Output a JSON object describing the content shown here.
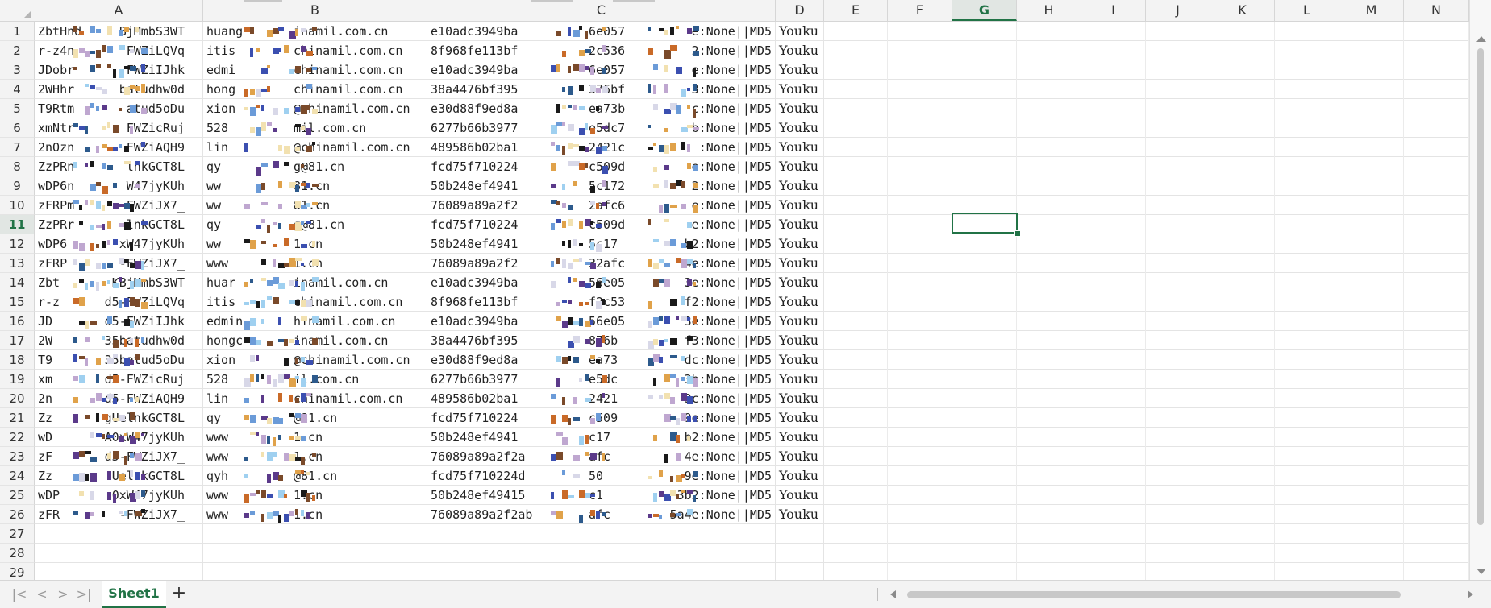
{
  "columns": [
    "A",
    "B",
    "C",
    "D",
    "E",
    "F",
    "G",
    "H",
    "I",
    "J",
    "K",
    "L",
    "M",
    "N"
  ],
  "selected_column": "G",
  "selected_row": "11",
  "row_numbers": [
    "1",
    "2",
    "3",
    "4",
    "5",
    "6",
    "7",
    "8",
    "9",
    "10",
    "11",
    "12",
    "13",
    "14",
    "15",
    "16",
    "17",
    "18",
    "19",
    "20",
    "21",
    "22",
    "23",
    "24",
    "25",
    "26",
    "27",
    "28",
    "29"
  ],
  "rows": [
    {
      "a": "ZbtHnd",
      "a2": "BjMmbS3WT",
      "b": "huang",
      "b2": "inamil.com.cn",
      "c": "e10adc3949ba",
      "c2": "6e057",
      "c3": "e:None||MD5",
      "d": "Youku"
    },
    {
      "a": "r-z4n",
      "a2": "FWZiLQVq",
      "b": "itis",
      "b2": "chinamil.com.cn",
      "c": "8f968fe113bf",
      "c2": "2c536",
      "c3": "2:None||MD5",
      "d": "Youku"
    },
    {
      "a": "JDobr",
      "a2": "FWZiIJhk",
      "b": "edmi",
      "b2": "chinamil.com.cn",
      "c": "e10adc3949ba",
      "c2": "6e057",
      "c3": "e:None||MD5",
      "d": "Youku"
    },
    {
      "a": "2WHhr",
      "a2": "batudhw0d",
      "b": "hong",
      "b2": "chinamil.com.cn",
      "c": "38a4476bf395",
      "c2": "376bf",
      "c3": "3:None||MD5",
      "d": "Youku"
    },
    {
      "a": "T9Rtm",
      "a2": "atud5oDu",
      "b": "xion",
      "b2": "@chinamil.com.cn",
      "c": "e30d88f9ed8a",
      "c2": "ea73b",
      "c3": "c:None||MD5",
      "d": "Youku"
    },
    {
      "a": "xmNtr",
      "a2": "FWZicRuj",
      "b": "528",
      "b2": "mil.com.cn",
      "c": "6277b66b3977",
      "c2": "e5dc7",
      "c3": "b:None||MD5",
      "d": "Youku"
    },
    {
      "a": "2nOzn",
      "a2": "FWZiAQH9",
      "b": "lin",
      "b2": "@chinamil.com.cn",
      "c": "489586b02ba1",
      "c2": "2421c",
      "c3": ":None||MD5",
      "d": "Youku"
    },
    {
      "a": "ZzPRn",
      "a2": "lnkGCT8L",
      "b": "qy",
      "b2": "g@81.cn",
      "c": "fcd75f710224",
      "c2": "c509d",
      "c3": "e:None||MD5",
      "d": "Youku"
    },
    {
      "a": "wDP6n",
      "a2": "W47jyKUh",
      "b": "ww",
      "b2": "81.cn",
      "c": "50b248ef4941",
      "c2": "5c172",
      "c3": "2:None||MD5",
      "d": "Youku"
    },
    {
      "a": "zFRPm",
      "a2": "FWZiJX7_",
      "b": "ww",
      "b2": "81.cn",
      "c": "76089a89a2f2",
      "c2": "2afc6",
      "c3": "e:None||MD5",
      "d": "Youku"
    },
    {
      "a": "ZzPRr",
      "a2": "lnkGCT8L",
      "b": "qy",
      "b2": "g@81.cn",
      "c": "fcd75f710224",
      "c2": "c509d",
      "c3": "e:None||MD5",
      "d": "Youku"
    },
    {
      "a": "wDP6",
      "a2": "xW47jyKUh",
      "b": "ww",
      "b2": "1.cn",
      "c": "50b248ef4941",
      "c2": "5c17",
      "c3": "b2:None||MD5",
      "d": "Youku"
    },
    {
      "a": "zFRP",
      "a2": "-FWZiJX7_",
      "b": "www",
      "b2": "1.cn",
      "c": "76089a89a2f2",
      "c2": "32afc",
      "c3": "4e:None||MD5",
      "d": "Youku"
    },
    {
      "a": "Zbt",
      "a2": "KBjMmbS3WT",
      "b": "huar",
      "b2": "inamil.com.cn",
      "c": "e10adc3949ba",
      "c2": "56e05",
      "c3": "3e:None||MD5",
      "d": "Youku"
    },
    {
      "a": "r-z",
      "a2": "d5-FWZiLQVq",
      "b": "itis",
      "b2": "chinamil.com.cn",
      "c": "8f968fe113bf",
      "c2": "f2c53",
      "c3": "f2:None||MD5",
      "d": "Youku"
    },
    {
      "a": "JD",
      "a2": "d5-FWZiIJhk",
      "b": "edmin",
      "b2": "hinamil.com.cn",
      "c": "e10adc3949ba",
      "c2": "56e05",
      "c3": "3e:None||MD5",
      "d": "Youku"
    },
    {
      "a": "2W",
      "a2": "35batudhw0d",
      "b": "hongc",
      "b2": "inamil.com.cn",
      "c": "38a4476bf395",
      "c2": "876b",
      "c3": "f3:None||MD5",
      "d": "Youku"
    },
    {
      "a": "T9",
      "a2": "35batud5oDu",
      "b": "xion",
      "b2": "@chinamil.com.cn",
      "c": "e30d88f9ed8a",
      "c2": "ea73",
      "c3": "dc:None||MD5",
      "d": "Youku"
    },
    {
      "a": "xm",
      "a2": "d5-FWZicRuj",
      "b": "528",
      "b2": "il.com.cn",
      "c": "6277b66b3977",
      "c2": "e5dc",
      "c3": "3b:None||MD5",
      "d": "Youku"
    },
    {
      "a": "2n",
      "a2": "d5-FWZiAQH9",
      "b": "lin",
      "b2": "chinamil.com.cn",
      "c": "489586b02ba1",
      "c2": "2421",
      "c3": "3c:None||MD5",
      "d": "Youku"
    },
    {
      "a": "Zz",
      "a2": "gUelnkGCT8L",
      "b": "qy",
      "b2": "@81.cn",
      "c": "fcd75f710224",
      "c2": "c509",
      "c3": "9e:None||MD5",
      "d": "Youku"
    },
    {
      "a": "wD",
      "a2": "A0xW47jyKUh",
      "b": "www",
      "b2": "1.cn",
      "c": "50b248ef4941",
      "c2": "c17",
      "c3": "b2:None||MD5",
      "d": "Youku"
    },
    {
      "a": "zF",
      "a2": "d5-FWZiJX7_",
      "b": "www",
      "b2": "1.cn",
      "c": "76089a89a2f2a",
      "c2": "afc",
      "c3": "4e:None||MD5",
      "d": "Youku"
    },
    {
      "a": "Zz",
      "a2": "UelnkGCT8L",
      "b": "qyh",
      "b2": "@81.cn",
      "c": "fcd75f710224d",
      "c2": "50",
      "c3": "9e:None||MD5",
      "d": "Youku"
    },
    {
      "a": "wDP",
      "a2": "0xW47jyKUh",
      "b": "www",
      "b2": "1.cn",
      "c": "50b248ef49415",
      "c2": "c1",
      "c3": "3b2:None||MD5",
      "d": "Youku"
    },
    {
      "a": "zFR",
      "a2": "-FWZiJX7_",
      "b": "www",
      "b2": "1.cn",
      "c": "76089a89a2f2ab",
      "c2": "afc",
      "c3": "5a4e:None||MD5",
      "d": "Youku"
    }
  ],
  "sheet_tab": "Sheet1",
  "add_sheet": "+",
  "nav": [
    "|<",
    "<",
    ">",
    ">|"
  ],
  "colors": {
    "accent": "#217346",
    "header_bg": "#f3f3f3",
    "grid_line": "#e4e4e4"
  }
}
